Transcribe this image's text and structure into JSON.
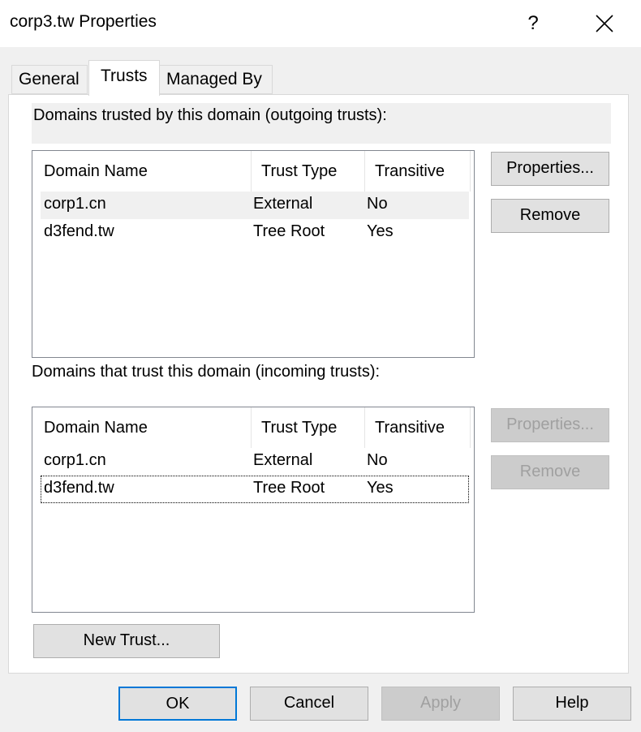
{
  "window": {
    "title": "corp3.tw Properties",
    "help_glyph": "?"
  },
  "tabs": [
    {
      "label": "General"
    },
    {
      "label": "Trusts"
    },
    {
      "label": "Managed By"
    }
  ],
  "outgoing": {
    "label": "Domains trusted by this domain (outgoing trusts):",
    "columns": [
      "Domain Name",
      "Trust Type",
      "Transitive"
    ],
    "rows": [
      {
        "domain": "corp1.cn",
        "type": "External",
        "transitive": "No"
      },
      {
        "domain": "d3fend.tw",
        "type": "Tree Root",
        "transitive": "Yes"
      }
    ],
    "properties_label": "Properties...",
    "remove_label": "Remove"
  },
  "incoming": {
    "label": "Domains that trust this domain (incoming trusts):",
    "columns": [
      "Domain Name",
      "Trust Type",
      "Transitive"
    ],
    "rows": [
      {
        "domain": "corp1.cn",
        "type": "External",
        "transitive": "No"
      },
      {
        "domain": "d3fend.tw",
        "type": "Tree Root",
        "transitive": "Yes"
      }
    ],
    "properties_label": "Properties...",
    "remove_label": "Remove"
  },
  "new_trust_label": "New Trust...",
  "footer": {
    "ok": "OK",
    "cancel": "Cancel",
    "apply": "Apply",
    "help": "Help"
  },
  "colors": {
    "accent": "#0078d7",
    "selected_row": "#f0f0f0",
    "disabled_text": "#a0a0a0"
  }
}
